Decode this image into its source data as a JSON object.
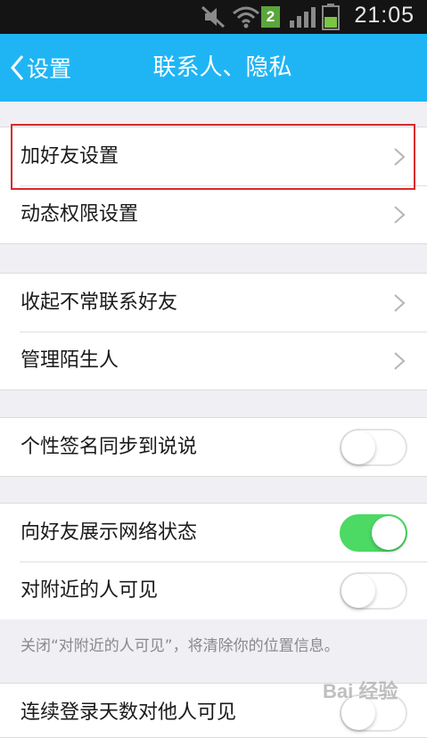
{
  "status_bar": {
    "time": "21:05",
    "badge": "2",
    "icons": [
      "mute-icon",
      "wifi-icon",
      "notification-badge",
      "signal-icon",
      "battery-icon"
    ]
  },
  "nav": {
    "back_label": "设置",
    "title": "联系人、隐私"
  },
  "groups": [
    {
      "items": [
        {
          "label": "加好友设置",
          "control": "chevron"
        },
        {
          "label": "动态权限设置",
          "control": "chevron"
        }
      ]
    },
    {
      "items": [
        {
          "label": "收起不常联系好友",
          "control": "chevron"
        },
        {
          "label": "管理陌生人",
          "control": "chevron"
        }
      ]
    },
    {
      "items": [
        {
          "label": "个性签名同步到说说",
          "control": "toggle",
          "state": "off"
        }
      ]
    },
    {
      "items": [
        {
          "label": "向好友展示网络状态",
          "control": "toggle",
          "state": "on"
        },
        {
          "label": "对附近的人可见",
          "control": "toggle",
          "state": "off"
        }
      ]
    },
    {
      "items": [
        {
          "label": "连续登录天数对他人可见",
          "control": "toggle",
          "state": "off"
        }
      ]
    }
  ],
  "note": "关闭“对附近的人可见”，将清除你的位置信息。",
  "watermark": "Bai 经验",
  "colors": {
    "nav_bar": "#1fb5f4",
    "toggle_on": "#4cd964",
    "highlight": "#d9292c",
    "background": "#efeff4"
  }
}
